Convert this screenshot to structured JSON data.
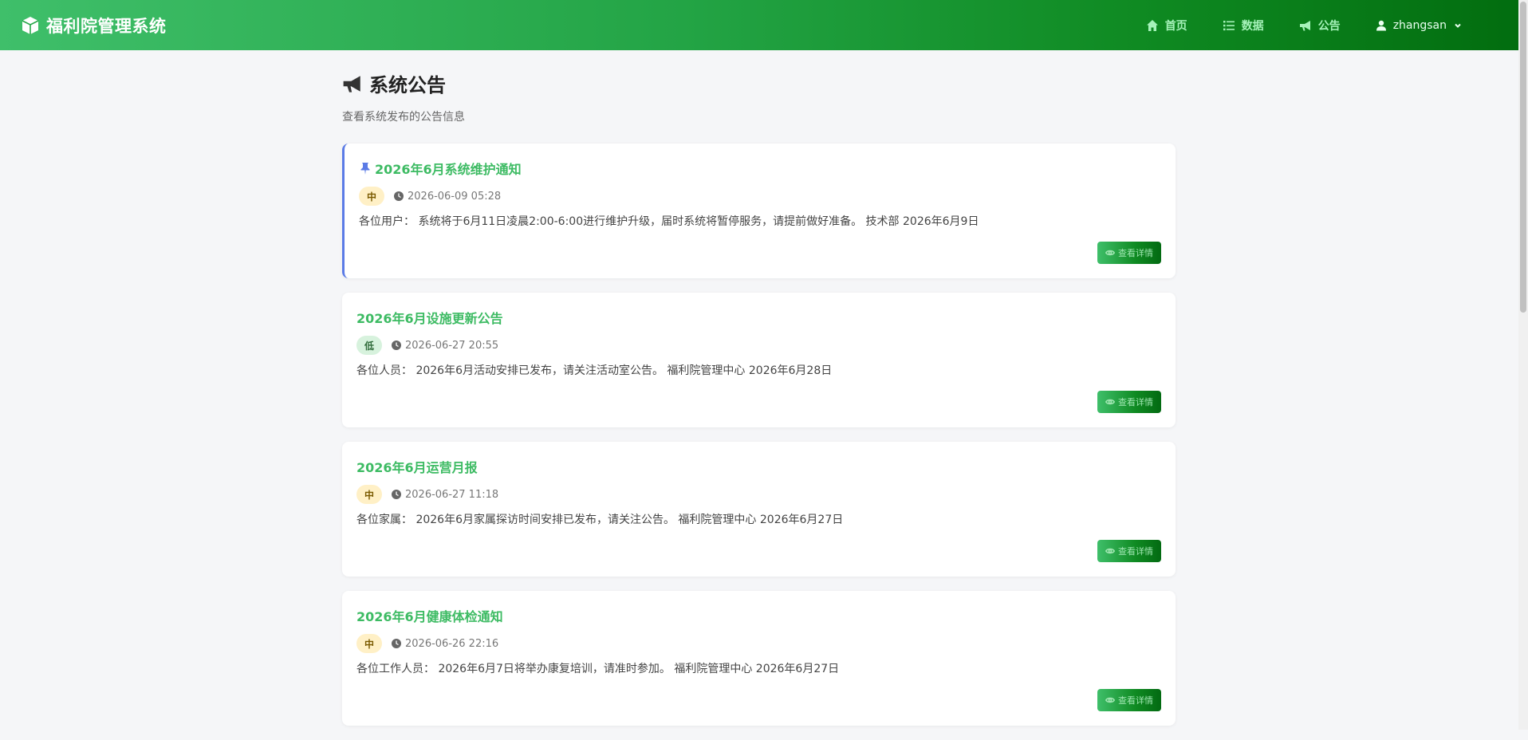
{
  "navbar": {
    "brand": "福利院管理系统",
    "items": [
      {
        "label": "首页",
        "icon": "home-icon"
      },
      {
        "label": "数据",
        "icon": "list-icon"
      },
      {
        "label": "公告",
        "icon": "megaphone-icon"
      }
    ],
    "user": {
      "name": "zhangsan",
      "icon": "user-icon"
    }
  },
  "page": {
    "title": "系统公告",
    "subtitle": "查看系统发布的公告信息"
  },
  "announcements": [
    {
      "title": "2026年6月系统维护通知",
      "pinned": true,
      "priority": "中",
      "time": "2026-06-09 05:28",
      "content": "各位用户： 系统将于6月11日凌晨2:00-6:00进行维护升级，届时系统将暂停服务，请提前做好准备。 技术部 2026年6月9日",
      "button": "查看详情"
    },
    {
      "title": "2026年6月设施更新公告",
      "pinned": false,
      "priority": "低",
      "time": "2026-06-27 20:55",
      "content": "各位人员： 2026年6月活动安排已发布，请关注活动室公告。 福利院管理中心 2026年6月28日",
      "button": "查看详情"
    },
    {
      "title": "2026年6月运营月报",
      "pinned": false,
      "priority": "中",
      "time": "2026-06-27 11:18",
      "content": "各位家属： 2026年6月家属探访时间安排已发布，请关注公告。 福利院管理中心 2026年6月27日",
      "button": "查看详情"
    },
    {
      "title": "2026年6月健康体检通知",
      "pinned": false,
      "priority": "中",
      "time": "2026-06-26 22:16",
      "content": "各位工作人员： 2026年6月7日将举办康复培训，请准时参加。 福利院管理中心 2026年6月27日",
      "button": "查看详情"
    }
  ]
}
